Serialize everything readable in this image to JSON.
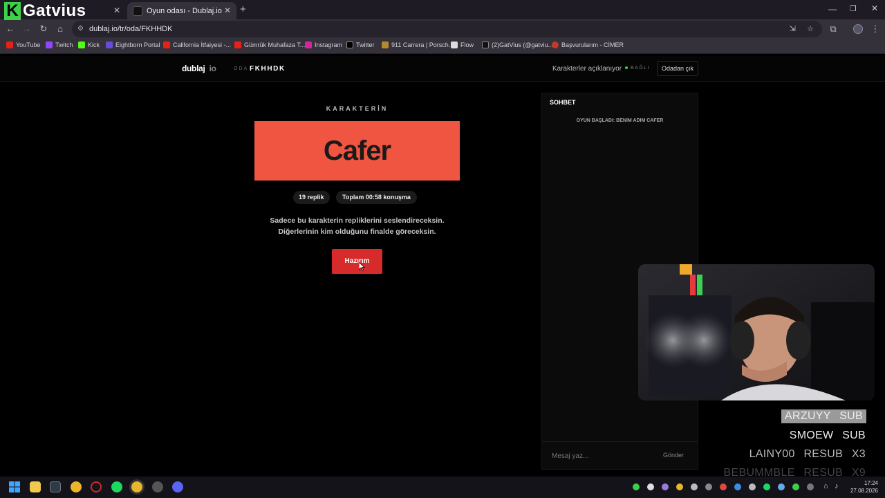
{
  "browser": {
    "tabs": [
      {
        "title": "Gatvius",
        "active": false
      },
      {
        "title": "Oyun odası - Dublaj.io",
        "active": true
      }
    ],
    "url": "dublaj.io/tr/oda/FKHHDK",
    "bookmarks": [
      "YouTube",
      "Twitch",
      "Kick",
      "Eightborn Portal",
      "California İtfaiyesi -...",
      "Gümrük Muhafaza T...",
      "Instagram",
      "Twitter",
      "911 Carrera | Porsch...",
      "Flow",
      "(2)GatVius (@gatviu...",
      "Başvurularım - CİMER"
    ]
  },
  "header": {
    "logo_main": "dublaj",
    "logo_suffix": "io",
    "room_label": "ODA",
    "room_code": "FKHHDK",
    "status_text": "Karakterler açıklanıyor",
    "connection": "BAĞLI",
    "leave_button": "Odadan çık"
  },
  "character": {
    "section_label": "KARAKTERİN",
    "name": "Cafer",
    "lines_count": "19 replik",
    "total_time": "Toplam 00:58 konuşma",
    "info_line1": "Sadece bu karakterin repliklerini seslendireceksin.",
    "info_line2": "Diğerlerinin kim olduğunu finalde göreceksin.",
    "ready_button": "Hazırım",
    "card_color": "#ef5540"
  },
  "chat": {
    "title": "SOHBET",
    "system_message": "OYUN BAŞLADI: BENIM ADIM CAFER",
    "input_placeholder": "Mesaj yaz...",
    "send_button": "Gönder"
  },
  "overlay": {
    "streamer_name": "Gatvius",
    "alerts": [
      "ARZUYY SUB",
      "SMOEW SUB",
      "LAINY00 RESUB X3",
      "BEBUMMBLE RESUB X9"
    ]
  },
  "taskbar": {
    "time": "17:24",
    "date": "27.08.2026"
  }
}
